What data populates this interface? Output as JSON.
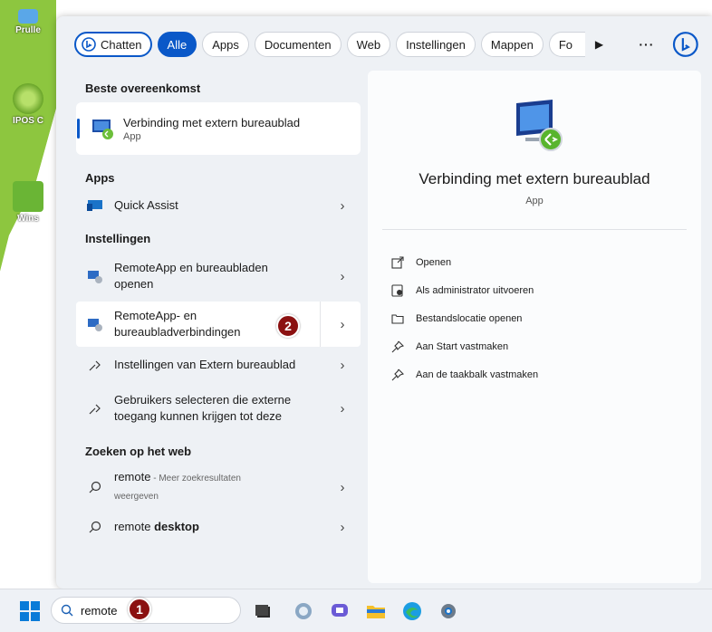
{
  "desktop": {
    "icons": [
      "Prulle",
      "IPOS C",
      "Wins"
    ]
  },
  "filters": {
    "chat": "Chatten",
    "all": "Alle",
    "apps": "Apps",
    "documents": "Documenten",
    "web": "Web",
    "settings": "Instellingen",
    "folders": "Mappen",
    "more_cut": "Fo",
    "overflow": "···"
  },
  "best_match": {
    "heading": "Beste overeenkomst",
    "title": "Verbinding met extern bureaublad",
    "type": "App"
  },
  "apps": {
    "heading": "Apps",
    "items": [
      {
        "label": "Quick Assist"
      }
    ]
  },
  "settings": {
    "heading": "Instellingen",
    "items": [
      {
        "line1": "RemoteApp en bureaubladen",
        "line2": "openen"
      },
      {
        "line1": "RemoteApp- en",
        "line2": "bureaubladverbindingen"
      },
      {
        "line1": "Instellingen van Extern bureaublad"
      },
      {
        "line1": "Gebruikers selecteren die externe",
        "line2": "toegang kunnen krijgen tot deze"
      }
    ]
  },
  "web": {
    "heading": "Zoeken op het web",
    "items": [
      {
        "term": "remote",
        "suffix": " - Meer zoekresultaten",
        "line2": "weergeven"
      },
      {
        "term": "remote ",
        "bold": "desktop"
      }
    ]
  },
  "detail": {
    "title": "Verbinding met extern bureaublad",
    "subtitle": "App",
    "actions": [
      {
        "icon": "open-external-icon",
        "label": "Openen"
      },
      {
        "icon": "admin-shield-icon",
        "label": "Als administrator uitvoeren"
      },
      {
        "icon": "folder-icon",
        "label": "Bestandslocatie openen"
      },
      {
        "icon": "pin-icon",
        "label": "Aan Start vastmaken"
      },
      {
        "icon": "pin-icon",
        "label": "Aan de taakbalk vastmaken"
      }
    ]
  },
  "taskbar": {
    "search_value": "remote"
  },
  "badges": [
    "1",
    "2"
  ],
  "colors": {
    "accent": "#0a58c8",
    "badge": "#8b1111",
    "desktop_green": "#8dc63f"
  }
}
